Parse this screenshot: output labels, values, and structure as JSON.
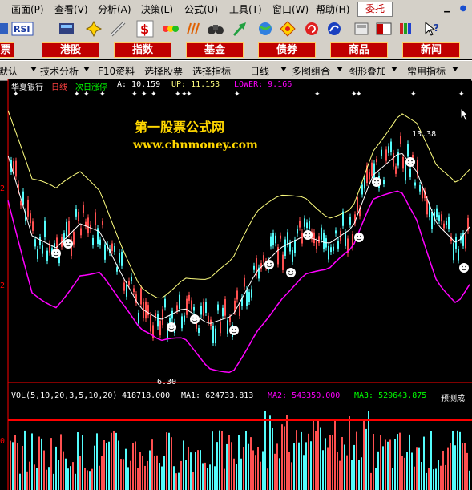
{
  "menu": {
    "items": [
      "画面(P)",
      "查看(V)",
      "分析(A)",
      "决策(L)",
      "公式(U)",
      "工具(T)",
      "窗口(W)",
      "帮助(H)"
    ],
    "trust_button": "委托"
  },
  "toolbar": {
    "icons": [
      "toolbar-icon",
      "rsi-icon",
      "calc-icon",
      "move-icon",
      "draw-icon",
      "dollar-icon",
      "traffic-icon",
      "bars-icon",
      "binoculars-icon",
      "arrow-icon",
      "globe-icon",
      "diamond-icon",
      "refresh-icon",
      "info-icon",
      "tablet-icon",
      "book-icon",
      "help-icon"
    ],
    "rsi_label": "RSI"
  },
  "categories": [
    "票",
    "港股",
    "指数",
    "基金",
    "债券",
    "商品",
    "新闻"
  ],
  "func_tabs": [
    "默认",
    "技术分析",
    "F10资料",
    "选择股票",
    "选择指标",
    "日线",
    "多图组合",
    "图形叠加",
    "常用指标"
  ],
  "main_chart": {
    "stock_name": "华夏银行",
    "period": "日线",
    "indicator_name": "次日涨停",
    "a_label": "A: 10.159",
    "up_label": "UP: 11.153",
    "lower_label": "LOWER: 9.166",
    "high_price_label": "13.38",
    "low_price_label": "6.30",
    "axis_marks": [
      "2",
      "2"
    ],
    "watermark_title": "第一股票公式网",
    "watermark_url": "www.chnmoney.com"
  },
  "vol_chart": {
    "vol_label": "VOL(5,10,20,3,5,10,20)",
    "vol_value": "418718.000",
    "ma1": "MA1: 624733.813",
    "ma2": "MA2: 543350.000",
    "ma3": "MA3: 529643.875",
    "forecast": "预测成",
    "axis_mark": "0"
  },
  "colors": {
    "up_candle": "#ff5050",
    "down_candle": "#54fcfc",
    "upper_band": "#ffff80",
    "mid_band": "#ffffff",
    "lower_band": "#ff00ff",
    "frame_red": "#ff0000"
  }
}
